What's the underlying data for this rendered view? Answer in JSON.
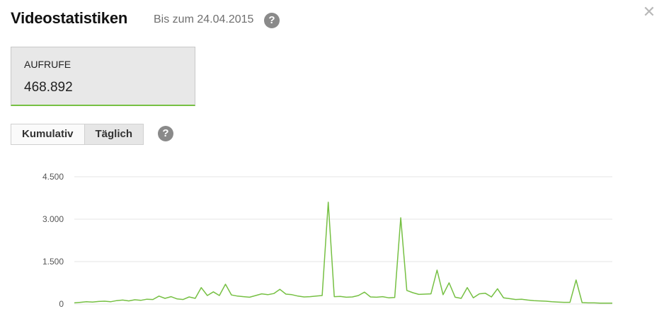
{
  "header": {
    "title": "Videostatistiken",
    "subtitle": "Bis zum 24.04.2015",
    "help_icon": "question-circle-icon",
    "close_icon": "close-x-icon",
    "close_glyph": "✕",
    "help_glyph": "?"
  },
  "metric": {
    "label": "AUFRUFE",
    "value": "468.892"
  },
  "view_toggle": {
    "options": [
      {
        "label": "Kumulativ",
        "active": false
      },
      {
        "label": "Täglich",
        "active": true
      }
    ]
  },
  "colors": {
    "accent": "#76c043",
    "grid": "#e6e6e6"
  },
  "chart_data": {
    "type": "line",
    "title": "",
    "xlabel": "",
    "ylabel": "",
    "ylim": [
      0,
      4500
    ],
    "yticks": [
      {
        "value": 0,
        "label": "0"
      },
      {
        "value": 1500,
        "label": "1.500"
      },
      {
        "value": 3000,
        "label": "3.000"
      },
      {
        "value": 4500,
        "label": "4.500"
      }
    ],
    "grid": true,
    "legend": "none",
    "series": [
      {
        "color": "#76c043",
        "values": [
          40,
          60,
          80,
          70,
          90,
          100,
          80,
          120,
          140,
          110,
          150,
          130,
          170,
          160,
          280,
          200,
          260,
          180,
          160,
          250,
          200,
          580,
          300,
          430,
          300,
          700,
          320,
          280,
          260,
          240,
          300,
          360,
          330,
          370,
          520,
          350,
          330,
          280,
          250,
          260,
          280,
          300,
          3600,
          260,
          270,
          240,
          250,
          300,
          420,
          250,
          240,
          260,
          220,
          230,
          3050,
          480,
          400,
          340,
          350,
          360,
          1200,
          330,
          750,
          240,
          200,
          580,
          220,
          360,
          380,
          250,
          540,
          220,
          190,
          160,
          170,
          140,
          120,
          110,
          100,
          80,
          70,
          60,
          60,
          850,
          50,
          40,
          40,
          30,
          30,
          30
        ]
      }
    ]
  }
}
